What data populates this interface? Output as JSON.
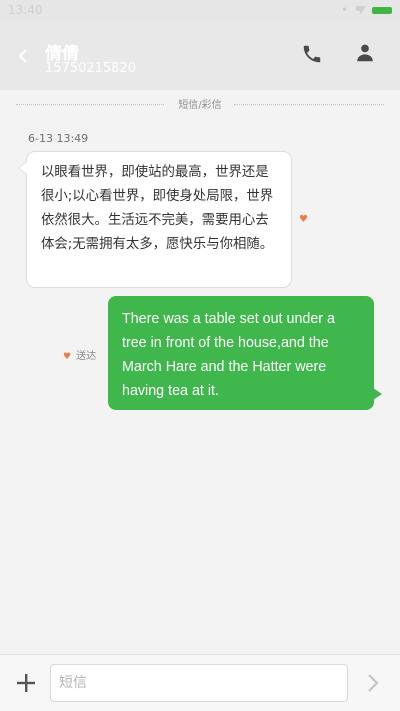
{
  "status_bar": {
    "time": "13:40",
    "dots": "• •",
    "battery_color": "#41b543"
  },
  "header": {
    "contact_name": "倩倩",
    "contact_number": "15750215820",
    "back_icon": "chevron-left-icon",
    "call_icon": "phone-icon",
    "contact_icon": "person-icon"
  },
  "thread": {
    "separator_label": "短信/彩信",
    "timestamp": "6-13 13:49",
    "messages": [
      {
        "direction": "incoming",
        "text": "以眼看世界，即使站的最高，世界还是很小;以心看世界，即使身处局限，世界依然很大。生活远不完美，需要用心去体会;无需拥有太多，愿快乐与你相随。",
        "icon": "heart-icon"
      },
      {
        "direction": "outgoing",
        "text": "There was a table set out under a tree in front of the house,and the March Hare and the Hatter were having tea at it.",
        "status": "送达",
        "status_icon": "heart-icon",
        "bubble_color": "#3fb74d"
      }
    ]
  },
  "composer": {
    "placeholder": "短信",
    "value": "",
    "add_icon": "plus-icon",
    "send_icon": "send-chevron-icon"
  }
}
